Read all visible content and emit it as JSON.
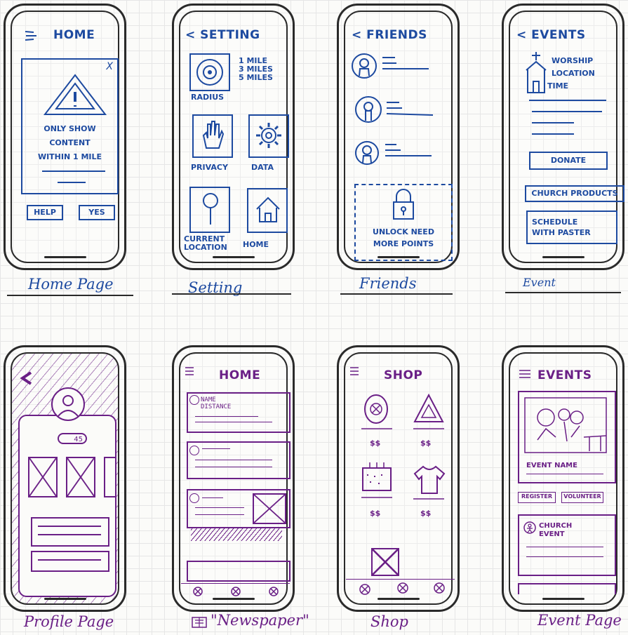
{
  "home_page": {
    "title": "HOME",
    "alert_text_1": "ONLY SHOW",
    "alert_text_2": "CONTENT",
    "alert_text_3": "WITHIN 1 MILE",
    "close": "X",
    "help_button": "HELP",
    "yes_button": "YES",
    "caption": "Home Page"
  },
  "setting_page": {
    "title": "< SETTING",
    "radius_options": [
      "1 MILE",
      "3 MILES",
      "5 MILES"
    ],
    "radius_label": "RADIUS",
    "privacy_label": "PRIVACY",
    "data_label": "DATA",
    "location_label_1": "CURRENT",
    "location_label_2": "LOCATION",
    "home_label": "HOME",
    "caption": "Setting"
  },
  "friends_page": {
    "title": "< FRIENDS",
    "unlock_text_1": "UNLOCK NEED",
    "unlock_text_2": "MORE POINTS",
    "caption": "Friends"
  },
  "event_page": {
    "title": "< EVENTS",
    "info_1": "WORSHIP",
    "info_2": "LOCATION",
    "info_3": "TIME",
    "donate_button": "DONATE",
    "products_button": "CHURCH PRODUCTS",
    "schedule_button_1": "SCHEDULE",
    "schedule_button_2": "WITH PASTER",
    "caption": "Event"
  },
  "profile_page": {
    "badge_count": "45",
    "caption": "Profile Page"
  },
  "newspaper_page": {
    "title": "HOME",
    "card_name": "NAME",
    "card_distance": "DISTANCE",
    "caption": "\"Newspaper\""
  },
  "shop_page": {
    "title": "SHOP",
    "price": "$$",
    "caption": "Shop"
  },
  "event_page_2": {
    "title": "EVENTS",
    "event_name": "EVENT NAME",
    "register_button": "REGISTER",
    "volunteer_button": "VOLUNTEER",
    "church_event_1": "CHURCH",
    "church_event_2": "EVENT",
    "caption": "Event Page"
  },
  "colors": {
    "blue_ink": "#1d4aa0",
    "purple_ink": "#6a1f86",
    "pen": "#2a2a2a"
  }
}
